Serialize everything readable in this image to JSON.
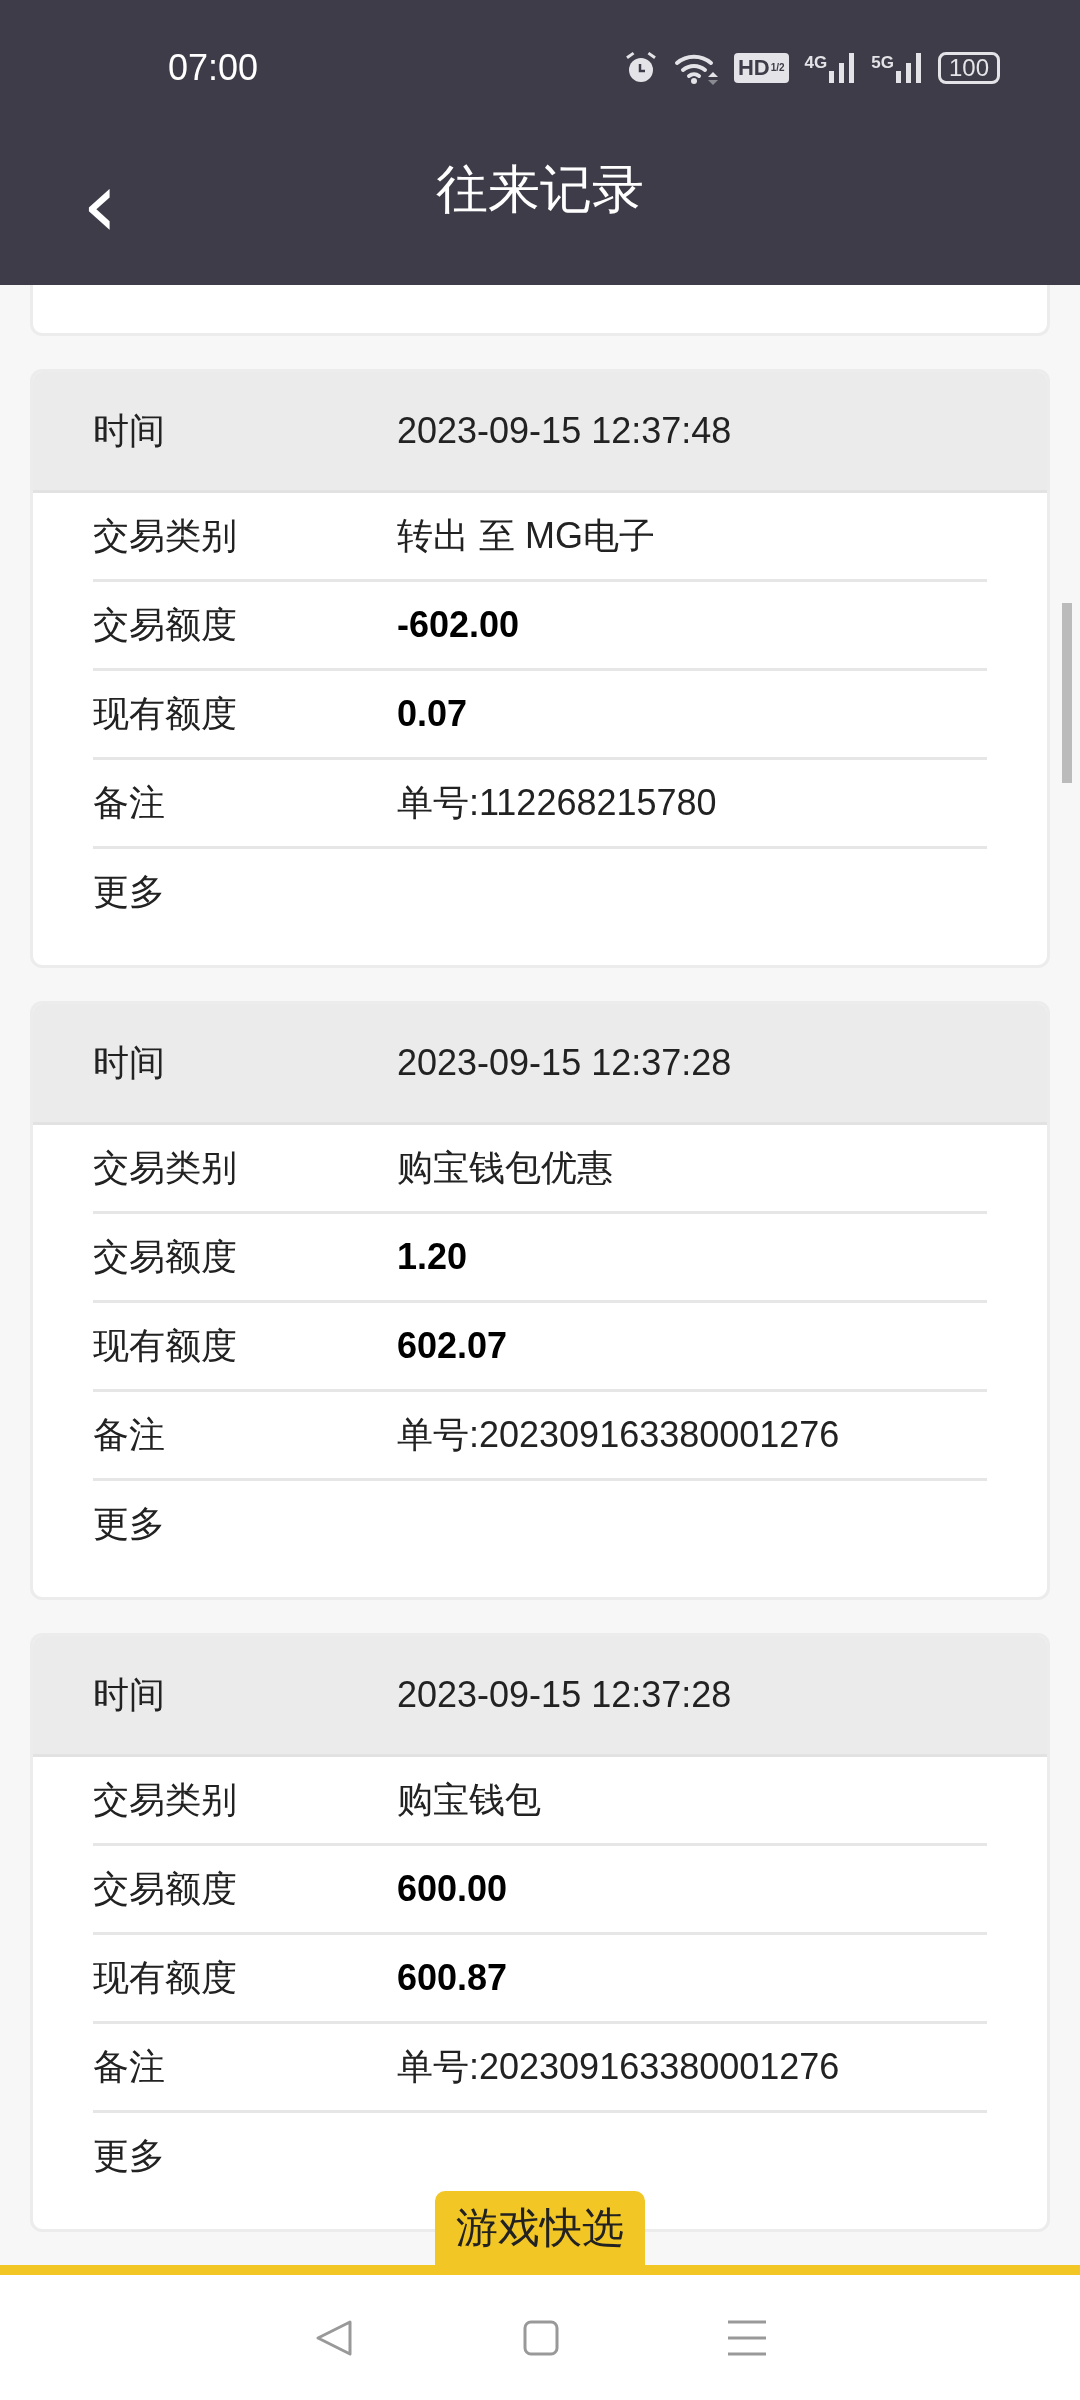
{
  "status_bar": {
    "time": "07:00",
    "hd_label": "HD",
    "hd_sub": "1/2",
    "signals": [
      "4G",
      "5G"
    ],
    "battery": "100"
  },
  "header": {
    "back_icon": "‹",
    "title": "往来记录"
  },
  "records": [
    {
      "time_label": "时间",
      "time": "2023-09-15 12:37:48",
      "rows": [
        {
          "kind": "text",
          "label": "交易类别",
          "value": "转出 至 MG电子"
        },
        {
          "kind": "amount",
          "label": "交易额度",
          "value": "-602.00"
        },
        {
          "kind": "amount",
          "label": "现有额度",
          "value": "0.07"
        },
        {
          "kind": "text",
          "label": "备注",
          "value": "单号:112268215780"
        },
        {
          "kind": "more",
          "label": "更多"
        }
      ]
    },
    {
      "time_label": "时间",
      "time": "2023-09-15 12:37:28",
      "rows": [
        {
          "kind": "text",
          "label": "交易类别",
          "value": "购宝钱包优惠"
        },
        {
          "kind": "amount",
          "label": "交易额度",
          "value": "1.20"
        },
        {
          "kind": "amount",
          "label": "现有额度",
          "value": "602.07"
        },
        {
          "kind": "text",
          "label": "备注",
          "value": "单号:202309163380001276"
        },
        {
          "kind": "more",
          "label": "更多"
        }
      ]
    },
    {
      "time_label": "时间",
      "time": "2023-09-15 12:37:28",
      "rows": [
        {
          "kind": "text",
          "label": "交易类别",
          "value": "购宝钱包"
        },
        {
          "kind": "amount",
          "label": "交易额度",
          "value": "600.00"
        },
        {
          "kind": "amount",
          "label": "现有额度",
          "value": "600.87"
        },
        {
          "kind": "text",
          "label": "备注",
          "value": "单号:202309163380001276"
        },
        {
          "kind": "more",
          "label": "更多"
        }
      ]
    }
  ],
  "quick_pick": "游戏快选"
}
